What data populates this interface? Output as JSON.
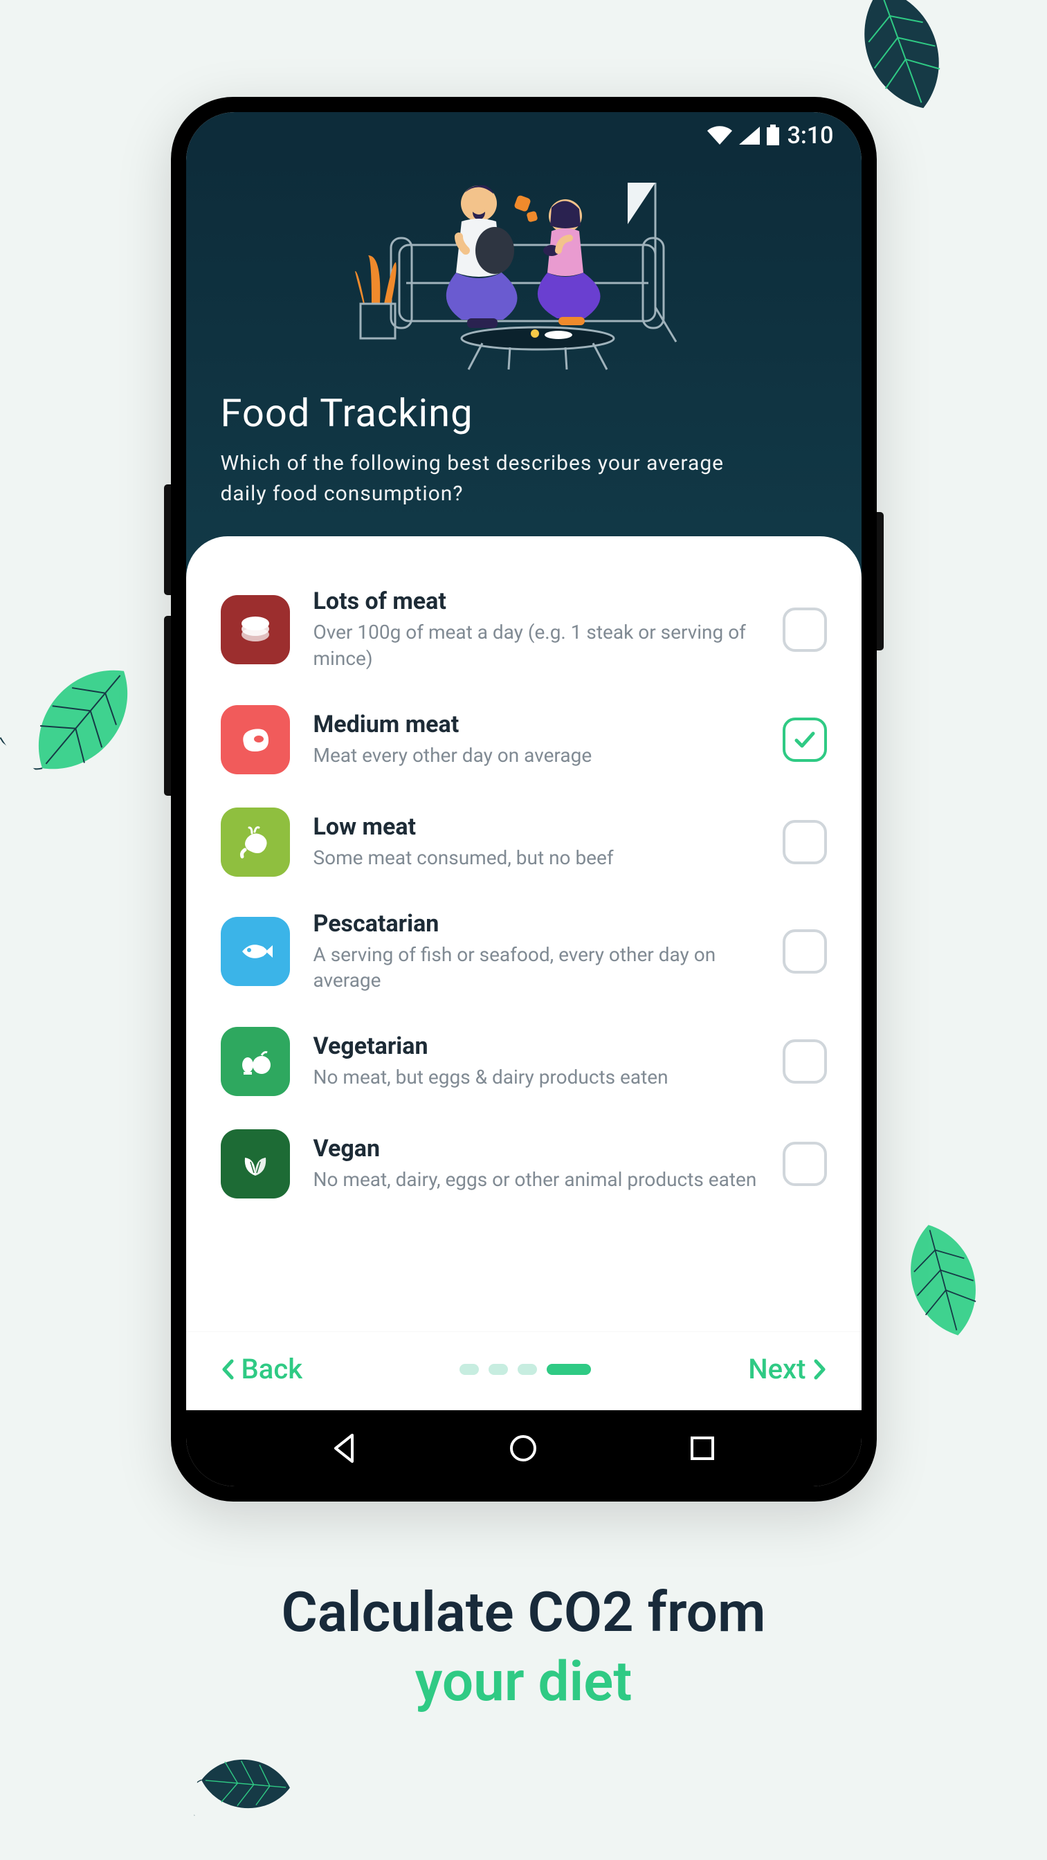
{
  "status": {
    "time": "3:10"
  },
  "header": {
    "title": "Food Tracking",
    "subtitle": "Which of the following best describes your average daily food consumption?"
  },
  "options": [
    {
      "title": "Lots of meat",
      "desc": "Over 100g of meat a day (e.g. 1 steak or serving of mince)",
      "color": "#9c2e2e",
      "selected": false
    },
    {
      "title": "Medium meat",
      "desc": "Meat every other day on average",
      "color": "#f15b5b",
      "selected": true
    },
    {
      "title": "Low meat",
      "desc": "Some meat consumed, but no beef",
      "color": "#8fbf3f",
      "selected": false
    },
    {
      "title": "Pescatarian",
      "desc": "A serving of fish or seafood, every other day on average",
      "color": "#3bb4e8",
      "selected": false
    },
    {
      "title": "Vegetarian",
      "desc": "No meat, but eggs & dairy products eaten",
      "color": "#2ea85f",
      "selected": false
    },
    {
      "title": "Vegan",
      "desc": "No meat, dairy, eggs or other animal products eaten",
      "color": "#1d6b35",
      "selected": false
    }
  ],
  "nav": {
    "back": "Back",
    "next": "Next"
  },
  "promo": {
    "line1": "Calculate CO2 from",
    "line2": "your diet"
  }
}
